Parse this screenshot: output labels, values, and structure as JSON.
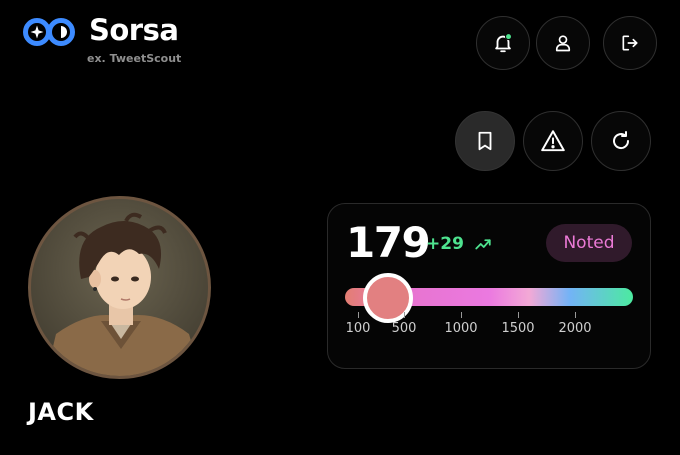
{
  "header": {
    "brand_name": "Sorsa",
    "brand_subtitle": "ex. TweetScout",
    "accent_color": "#3d8bff",
    "notification_dot_color": "#4ee38f"
  },
  "header_actions": [
    {
      "name": "bell-icon",
      "label": "notifications"
    },
    {
      "name": "user-icon",
      "label": "profile"
    },
    {
      "name": "logout-icon",
      "label": "log out"
    }
  ],
  "profile_actions": [
    {
      "name": "bookmark-icon",
      "label": "bookmark",
      "active": true
    },
    {
      "name": "warning-icon",
      "label": "report"
    },
    {
      "name": "refresh-icon",
      "label": "refresh"
    }
  ],
  "profile": {
    "username": "JACK"
  },
  "score_card": {
    "score": "179",
    "delta": "+29",
    "delta_color": "#4ee38f",
    "status_badge": "Noted",
    "status_color": "#eb7ad6",
    "slider": {
      "value": 179,
      "ticks": [
        "100",
        "500",
        "1000",
        "1500",
        "2000"
      ]
    }
  }
}
